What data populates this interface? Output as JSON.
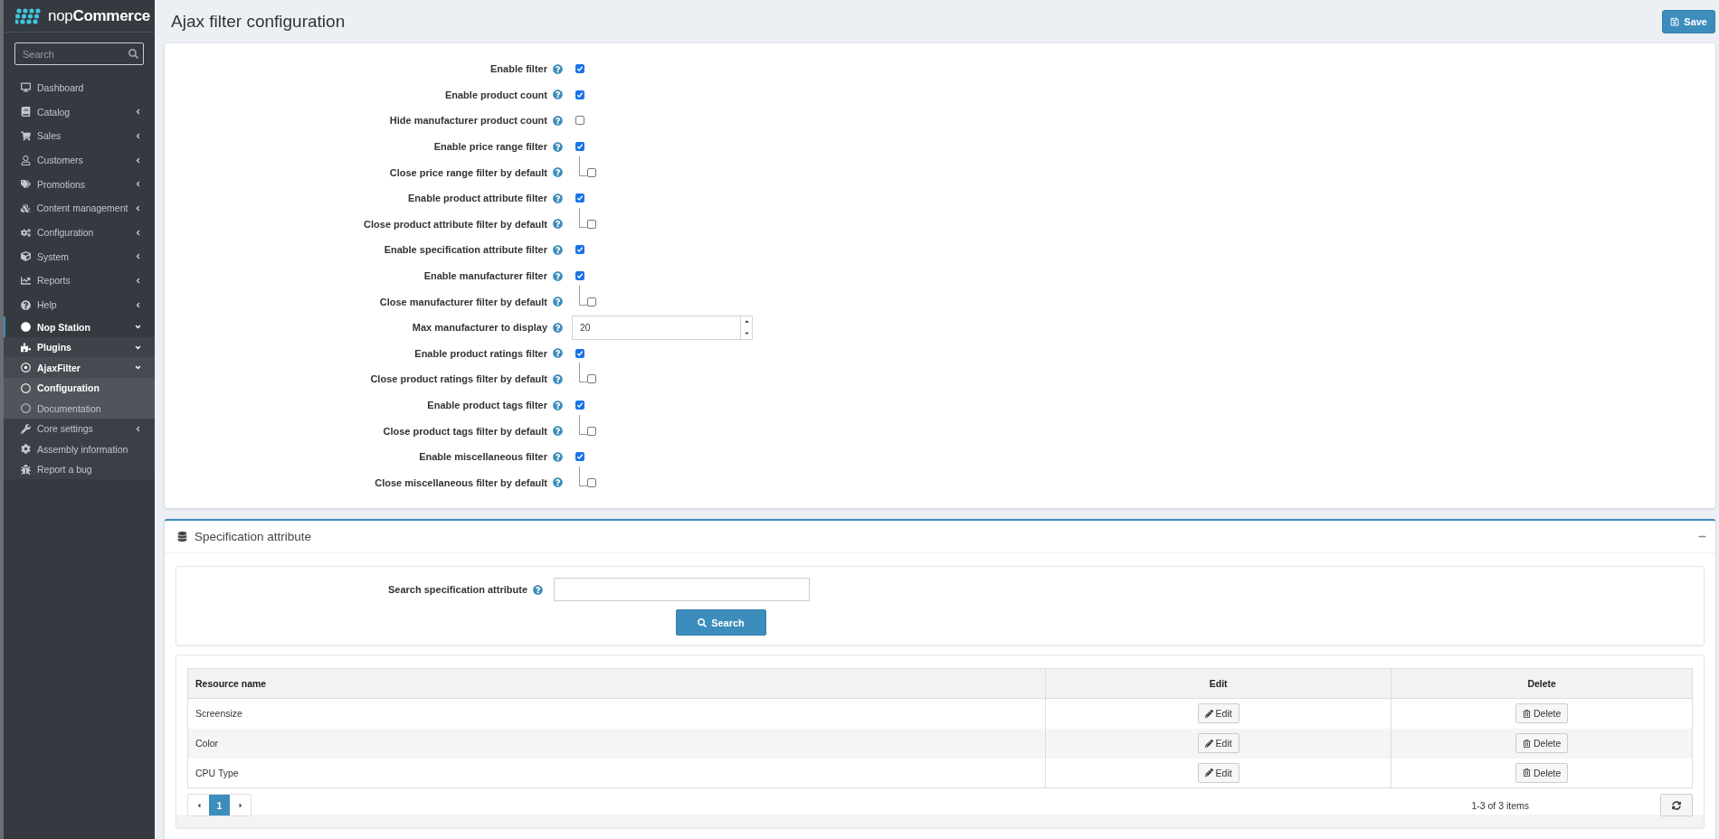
{
  "sidebar": {
    "logo": {
      "prefix": "nop",
      "name": "Commerce"
    },
    "search": {
      "placeholder": "Search"
    },
    "items": [
      {
        "label": "Dashboard",
        "selected": false
      },
      {
        "label": "Catalog",
        "selected": false,
        "expanded": false
      },
      {
        "label": "Sales",
        "selected": false,
        "expanded": false
      },
      {
        "label": "Customers",
        "selected": false,
        "expanded": false
      },
      {
        "label": "Promotions",
        "selected": false,
        "expanded": false
      },
      {
        "label": "Content management",
        "selected": false,
        "expanded": false
      },
      {
        "label": "Configuration",
        "selected": false,
        "expanded": false
      },
      {
        "label": "System",
        "selected": false,
        "expanded": false
      },
      {
        "label": "Reports",
        "selected": false,
        "expanded": false
      },
      {
        "label": "Help",
        "selected": false,
        "expanded": false
      },
      {
        "label": "Nop Station",
        "selected": true,
        "expanded": true,
        "children": [
          {
            "label": "Plugins",
            "expanded": true,
            "children": [
              {
                "label": "AjaxFilter",
                "expanded": true,
                "children": [
                  {
                    "label": "Configuration",
                    "selected": true
                  },
                  {
                    "label": "Documentation",
                    "selected": false
                  }
                ]
              }
            ]
          },
          {
            "label": "Core settings",
            "selected": false,
            "expanded": false
          },
          {
            "label": "Assembly information",
            "selected": false
          },
          {
            "label": "Report a bug",
            "selected": false
          }
        ]
      }
    ]
  },
  "page": {
    "title": "Ajax filter configuration",
    "save_button": "Save"
  },
  "settings": [
    {
      "kind": "checkbox",
      "label": "Enable filter",
      "checked": true
    },
    {
      "kind": "checkbox",
      "label": "Enable product count",
      "checked": true
    },
    {
      "kind": "checkbox",
      "label": "Hide manufacturer product count",
      "checked": false
    },
    {
      "kind": "checkbox",
      "label": "Enable price range filter",
      "checked": true
    },
    {
      "kind": "sub-checkbox",
      "label": "Close price range filter by default",
      "checked": false
    },
    {
      "kind": "checkbox",
      "label": "Enable product attribute filter",
      "checked": true
    },
    {
      "kind": "sub-checkbox",
      "label": "Close product attribute filter by default",
      "checked": false
    },
    {
      "kind": "checkbox",
      "label": "Enable specification attribute filter",
      "checked": true
    },
    {
      "kind": "checkbox",
      "label": "Enable manufacturer filter",
      "checked": true
    },
    {
      "kind": "sub-checkbox",
      "label": "Close manufacturer filter by default",
      "checked": false
    },
    {
      "kind": "number",
      "label": "Max manufacturer to display",
      "value": "20"
    },
    {
      "kind": "checkbox",
      "label": "Enable product ratings filter",
      "checked": true
    },
    {
      "kind": "sub-checkbox",
      "label": "Close product ratings filter by default",
      "checked": false
    },
    {
      "kind": "checkbox",
      "label": "Enable product tags filter",
      "checked": true
    },
    {
      "kind": "sub-checkbox",
      "label": "Close product tags filter by default",
      "checked": false
    },
    {
      "kind": "checkbox",
      "label": "Enable miscellaneous filter",
      "checked": true
    },
    {
      "kind": "sub-checkbox",
      "label": "Close miscellaneous filter by default",
      "checked": false
    }
  ],
  "spec_panel": {
    "title": "Specification attribute",
    "expanded": true,
    "search_label": "Search specification attribute",
    "search_button": "Search",
    "table": {
      "columns": [
        "Resource name",
        "Edit",
        "Delete"
      ],
      "rows": [
        {
          "name": "Screensize",
          "edit": "Edit",
          "delete": "Delete"
        },
        {
          "name": "Color",
          "edit": "Edit",
          "delete": "Delete"
        },
        {
          "name": "CPU Type",
          "edit": "Edit",
          "delete": "Delete"
        }
      ]
    },
    "pages": [
      {
        "label": "1",
        "selected": true
      }
    ],
    "summary": "1-3 of 3 items"
  }
}
